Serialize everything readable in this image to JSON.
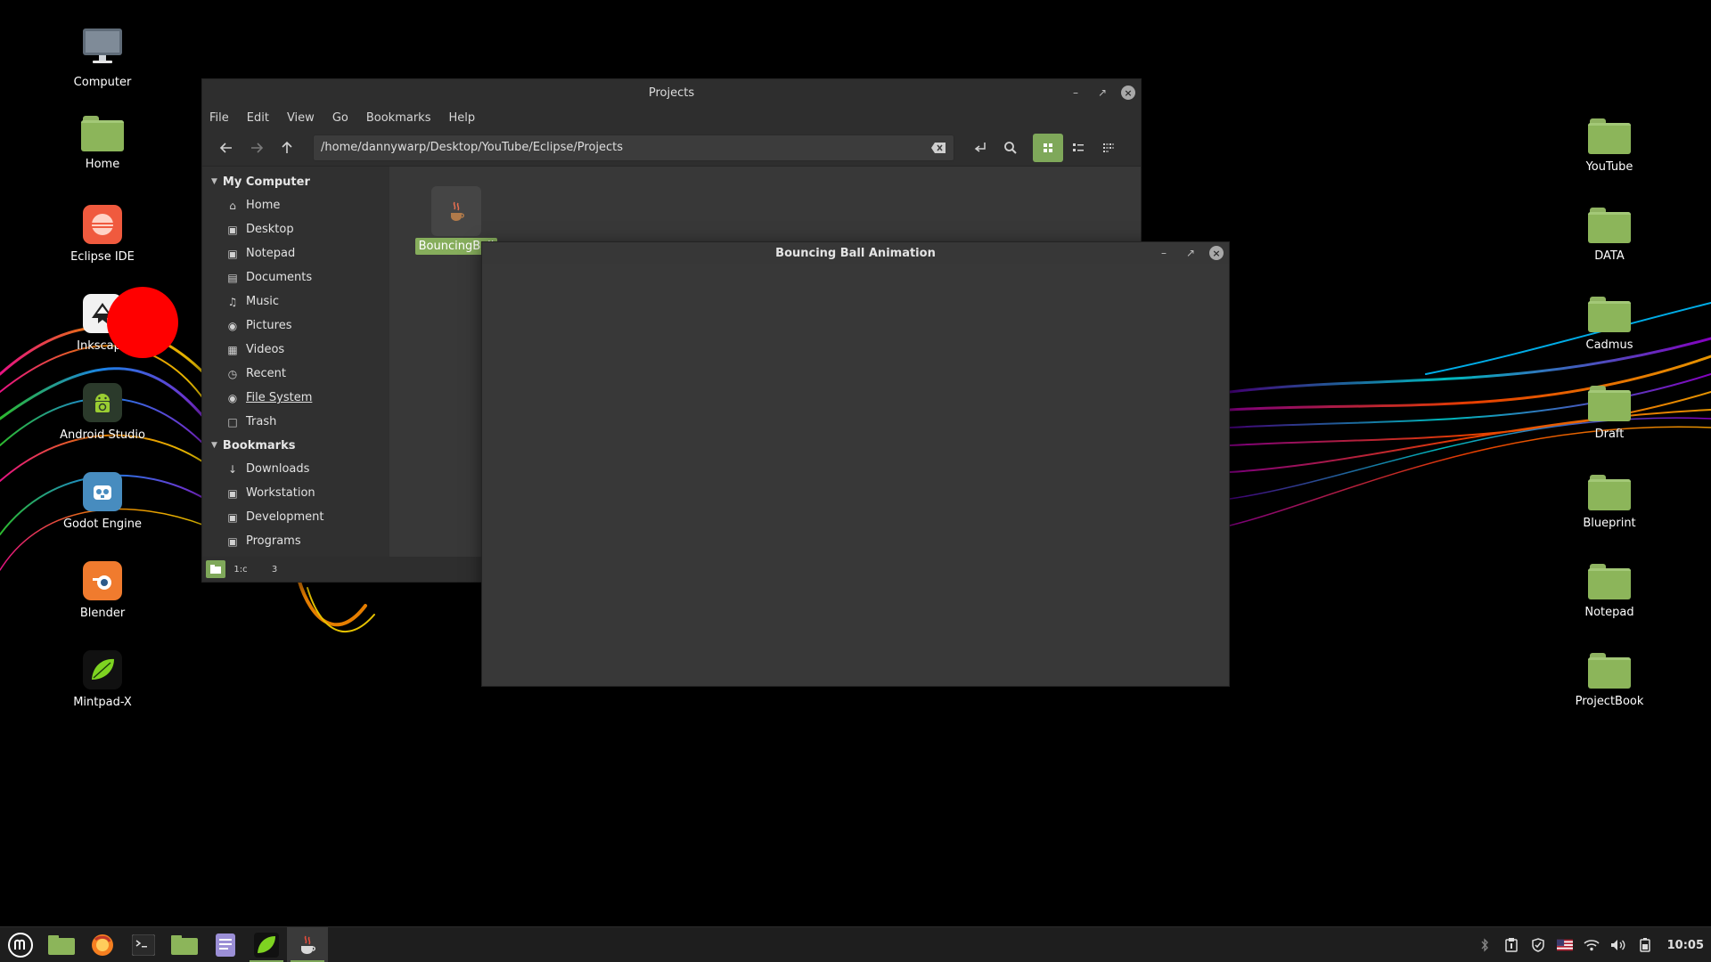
{
  "desktop": {
    "left_icons": [
      {
        "label": "Computer",
        "icon": "monitor-icon"
      },
      {
        "label": "Home",
        "icon": "home-folder-icon"
      },
      {
        "label": "Eclipse IDE",
        "icon": "eclipse-icon"
      },
      {
        "label": "Inkscape",
        "icon": "inkscape-icon"
      },
      {
        "label": "Android Studio",
        "icon": "android-icon"
      },
      {
        "label": "Godot Engine",
        "icon": "godot-icon"
      },
      {
        "label": "Blender",
        "icon": "blender-icon"
      },
      {
        "label": "Mintpad-X",
        "icon": "leaf-icon"
      }
    ],
    "right_icons": [
      {
        "label": "YouTube"
      },
      {
        "label": "DATA"
      },
      {
        "label": "Cadmus"
      },
      {
        "label": "Draft"
      },
      {
        "label": "Blueprint"
      },
      {
        "label": "Notepad"
      },
      {
        "label": "ProjectBook"
      }
    ]
  },
  "file_manager": {
    "title": "Projects",
    "menu": [
      "File",
      "Edit",
      "View",
      "Go",
      "Bookmarks",
      "Help"
    ],
    "path": "/home/dannywarp/Desktop/YouTube/Eclipse/Projects",
    "sidebar": {
      "sections": [
        {
          "title": "My Computer",
          "items": [
            {
              "label": "Home",
              "icon": "home-icon"
            },
            {
              "label": "Desktop",
              "icon": "folder-icon"
            },
            {
              "label": "Notepad",
              "icon": "folder-icon"
            },
            {
              "label": "Documents",
              "icon": "document-icon"
            },
            {
              "label": "Music",
              "icon": "music-icon"
            },
            {
              "label": "Pictures",
              "icon": "camera-icon"
            },
            {
              "label": "Videos",
              "icon": "film-icon"
            },
            {
              "label": "Recent",
              "icon": "clock-icon"
            },
            {
              "label": "File System",
              "icon": "drive-icon"
            },
            {
              "label": "Trash",
              "icon": "trash-icon"
            }
          ]
        },
        {
          "title": "Bookmarks",
          "items": [
            {
              "label": "Downloads",
              "icon": "download-icon"
            },
            {
              "label": "Workstation",
              "icon": "folder-icon"
            },
            {
              "label": "Development",
              "icon": "folder-icon"
            },
            {
              "label": "Programs",
              "icon": "folder-icon"
            }
          ]
        }
      ]
    },
    "files": [
      {
        "name": "BouncingBall",
        "icon": "java-icon"
      }
    ],
    "statusbar": {
      "btn2": "1:c",
      "btn3": "3"
    }
  },
  "ball_window": {
    "title": "Bouncing Ball Animation",
    "ball_color": "#ff0000"
  },
  "taskbar": {
    "launchers": [
      "mint-menu-icon",
      "folder-icon",
      "firefox-icon",
      "terminal-icon",
      "files-icon",
      "text-editor-icon",
      "mintpad-icon",
      "java-icon"
    ],
    "clock": "10:05"
  },
  "colors": {
    "accent": "#7fa85a",
    "folder": "#8cb55a",
    "window_bg": "#383838",
    "titlebar": "#2e2e2e"
  }
}
